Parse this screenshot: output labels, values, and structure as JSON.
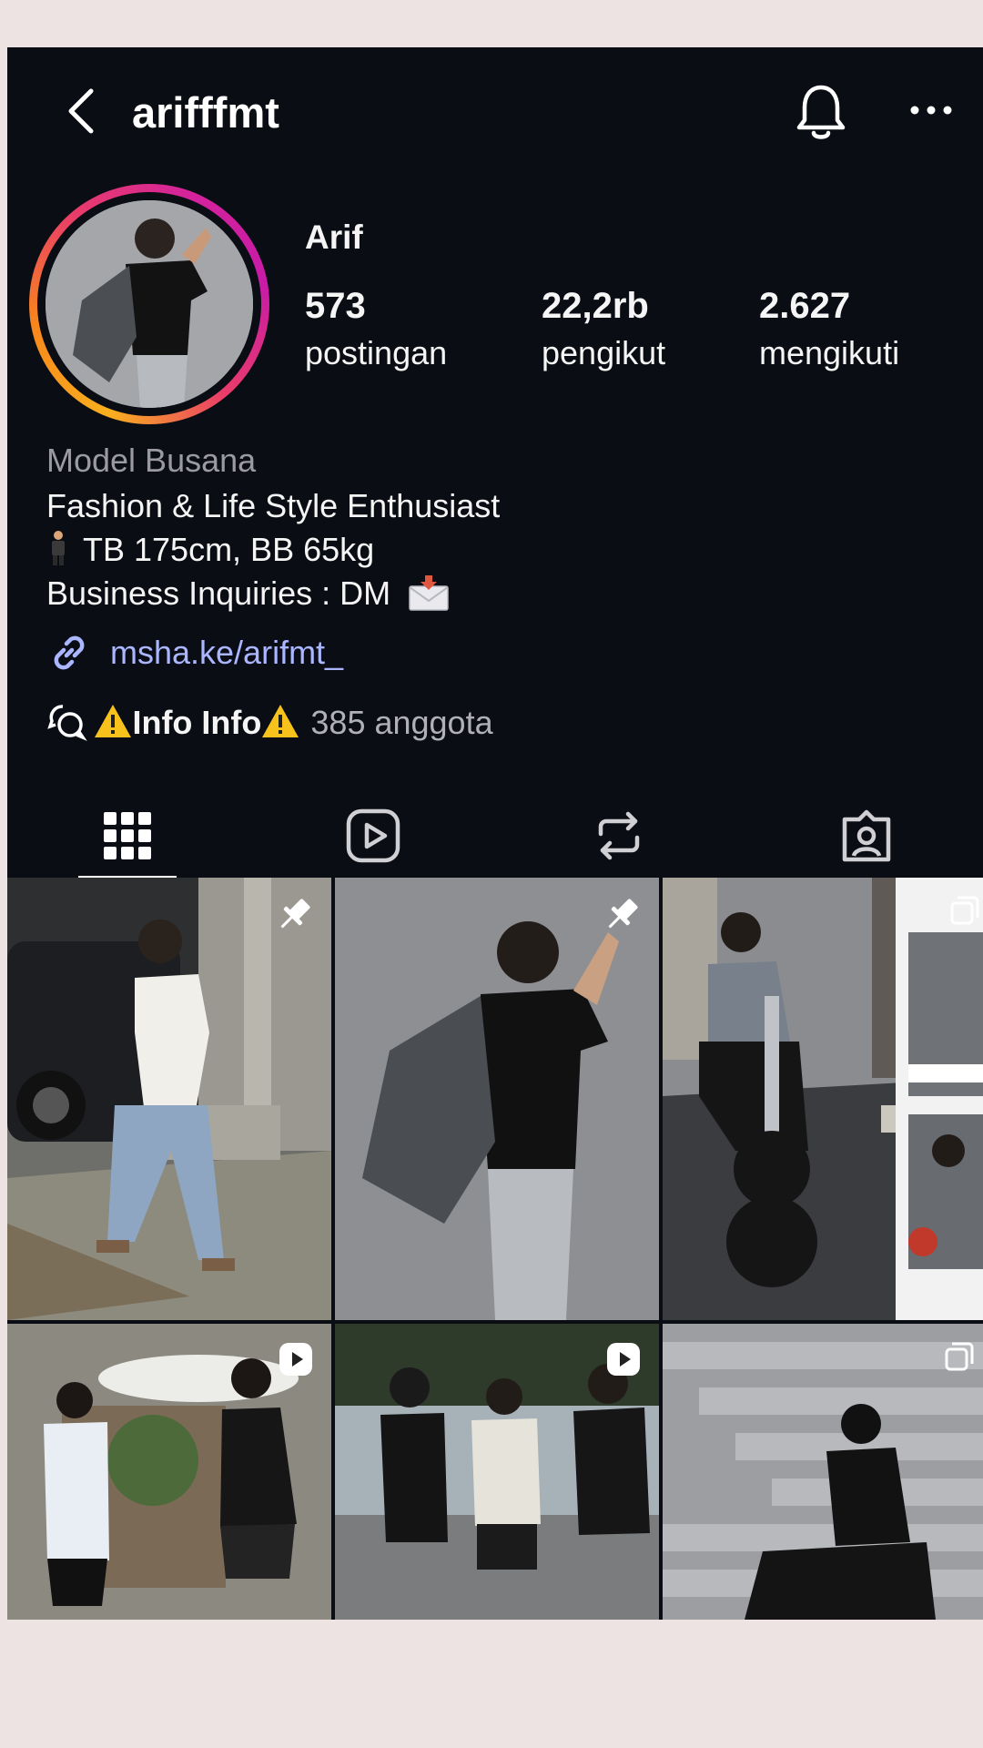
{
  "profile": {
    "username": "arifffmt",
    "display_name": "Arif"
  },
  "stats": [
    {
      "value": "573",
      "label": "postingan"
    },
    {
      "value": "22,2rb",
      "label": "pengikut"
    },
    {
      "value": "2.627",
      "label": "mengikuti"
    }
  ],
  "bio": {
    "category": "Model Busana",
    "line1": "Fashion & Life Style Enthusiast",
    "line2": "TB 175cm, BB 65kg",
    "line3": "Business Inquiries : DM",
    "link": "msha.ke/arifmt_"
  },
  "channel": {
    "name": "Info Info",
    "members": "385 anggota"
  },
  "tabs": [
    {
      "icon": "grid-icon"
    },
    {
      "icon": "reels-icon"
    },
    {
      "icon": "reposts-icon"
    },
    {
      "icon": "tagged-icon"
    }
  ],
  "posts": [
    {
      "type": "pinned-photo"
    },
    {
      "type": "pinned-photo"
    },
    {
      "type": "photo"
    },
    {
      "type": "carousel"
    },
    {
      "type": "reel"
    },
    {
      "type": "reel"
    },
    {
      "type": "carousel"
    }
  ],
  "colors": {
    "background": "#0b0d14",
    "link": "#aab6ff",
    "ring_start": "#f9b01e",
    "ring_end": "#c81ba7",
    "page_margin": "#ede3e2"
  }
}
